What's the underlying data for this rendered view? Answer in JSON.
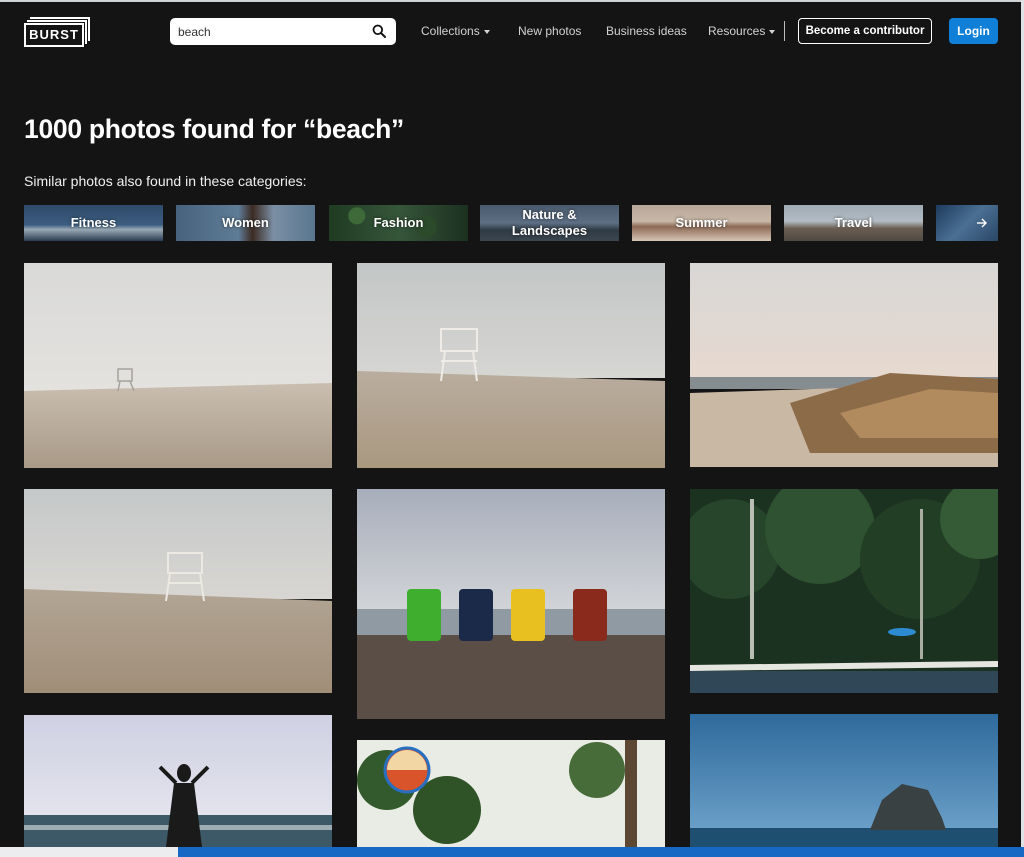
{
  "header": {
    "logo_text": "BURST",
    "search": {
      "value": "beach"
    },
    "nav": {
      "collections": "Collections",
      "new_photos": "New photos",
      "business_ideas": "Business ideas",
      "resources": "Resources"
    },
    "become_contributor": "Become a contributor",
    "login": "Login"
  },
  "results": {
    "title": "1000 photos found for “beach”",
    "similar_label": "Similar photos also found in these categories:"
  },
  "categories": [
    {
      "label": "Fitness"
    },
    {
      "label": "Women"
    },
    {
      "label": "Fashion"
    },
    {
      "label": "Nature & Landscapes"
    },
    {
      "label": "Summer"
    },
    {
      "label": "Travel"
    }
  ],
  "category_next_icon": "arrow-right-icon",
  "colors": {
    "background": "#141414",
    "login_blue": "#0f7fd8",
    "text": "#ffffff"
  }
}
